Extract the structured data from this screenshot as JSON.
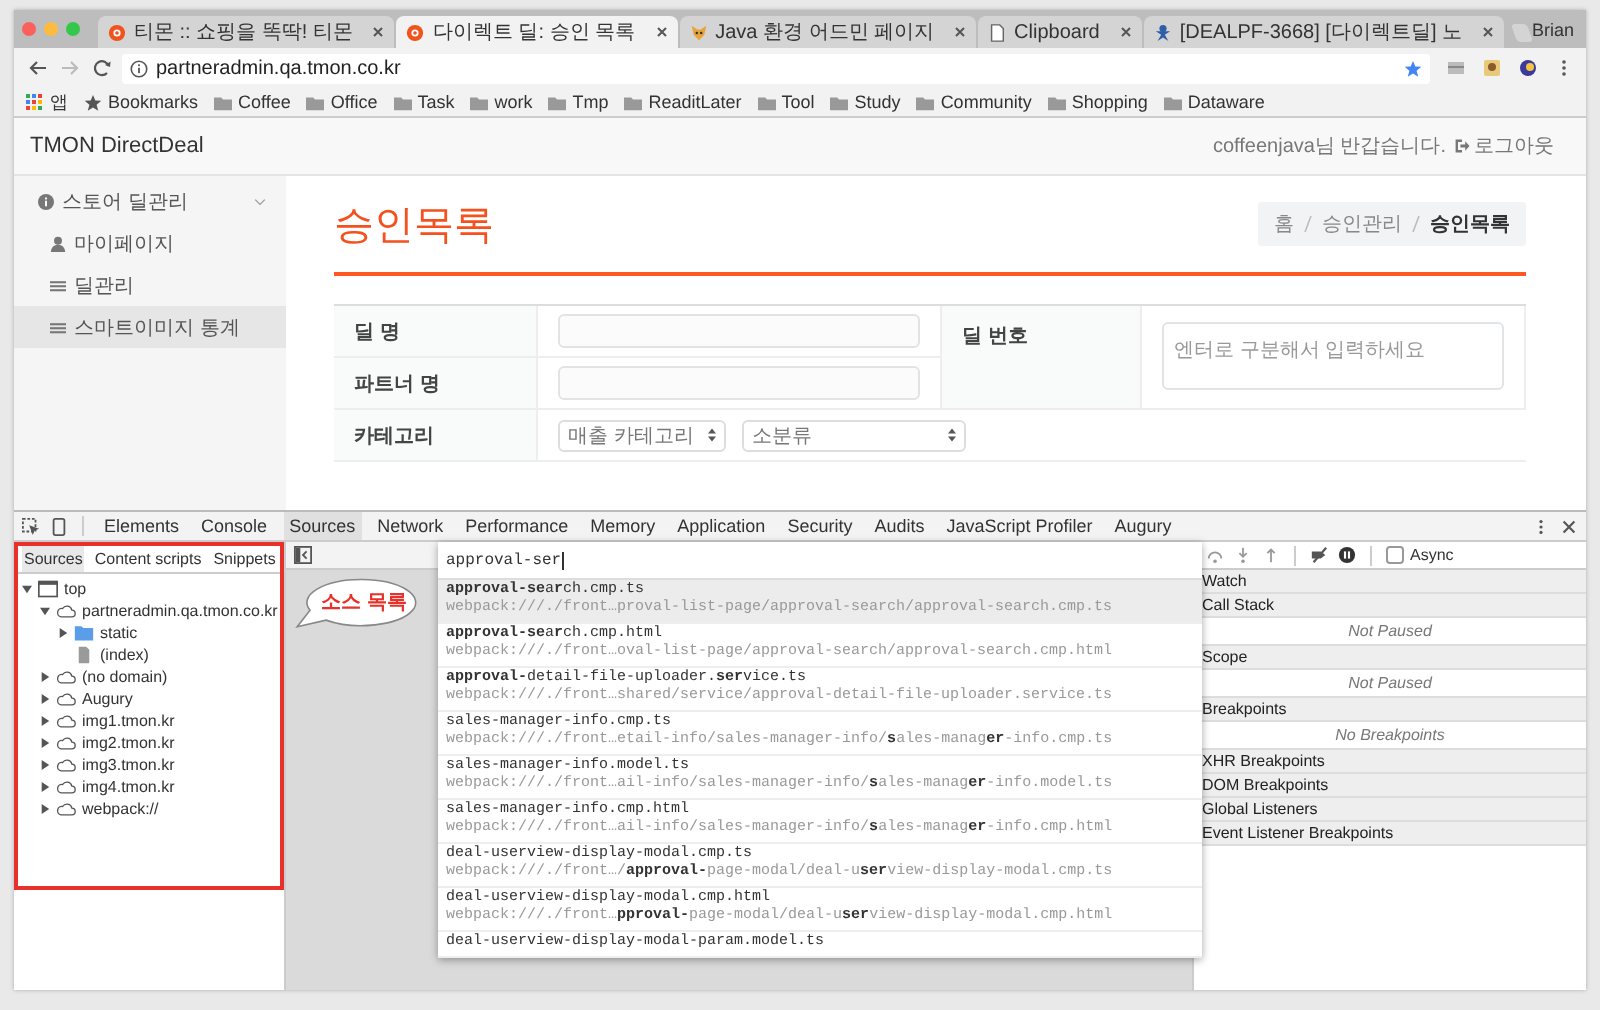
{
  "browser": {
    "tabs": [
      {
        "title": "티몬 :: 쇼핑을 똑딱! 티몬",
        "kind": "circle",
        "selected": false
      },
      {
        "title": "다이렉트 딜: 승인 목록",
        "kind": "circle",
        "selected": true
      },
      {
        "title": "Java 환경 어드민 페이지",
        "kind": "fox",
        "selected": false
      },
      {
        "title": "Clipboard",
        "kind": "page",
        "selected": false
      },
      {
        "title": "[DEALPF-3668] [다이렉트딜] 노",
        "kind": "figure",
        "selected": false
      }
    ],
    "user": "Brian",
    "url": "partneradmin.qa.tmon.co.kr",
    "bookmarks": [
      {
        "label": "앱",
        "kind": "apps"
      },
      {
        "label": "Bookmarks",
        "kind": "star"
      },
      {
        "label": "Coffee",
        "kind": "folder"
      },
      {
        "label": "Office",
        "kind": "folder"
      },
      {
        "label": "Task",
        "kind": "folder"
      },
      {
        "label": "work",
        "kind": "folder"
      },
      {
        "label": "Tmp",
        "kind": "folder"
      },
      {
        "label": "ReaditLater",
        "kind": "folder"
      },
      {
        "label": "Tool",
        "kind": "folder"
      },
      {
        "label": "Study",
        "kind": "folder"
      },
      {
        "label": "Community",
        "kind": "folder"
      },
      {
        "label": "Shopping",
        "kind": "folder"
      },
      {
        "label": "Dataware",
        "kind": "folder"
      }
    ]
  },
  "page": {
    "brand": "TMON DirectDeal",
    "greeting": "coffeenjava님 반갑습니다.",
    "logout": "로그아웃",
    "sidebar": {
      "group": {
        "label": "스토어 딜관리",
        "expanded": true
      },
      "items": [
        {
          "label": "마이페이지",
          "kind": "user",
          "selected": false
        },
        {
          "label": "딜관리",
          "kind": "list",
          "selected": false
        },
        {
          "label": "스마트이미지 통계",
          "kind": "list",
          "selected": true
        }
      ]
    },
    "title": "승인목록",
    "breadcrumb": [
      {
        "label": "홈",
        "current": false
      },
      {
        "label": "승인관리",
        "current": false
      },
      {
        "label": "승인목록",
        "current": true
      }
    ],
    "form": {
      "deal_name": "딜 명",
      "partner_name": "파트너 명",
      "deal_number": "딜 번호",
      "deal_number_placeholder": "엔터로 구분해서 입력하세요",
      "category": "카테고리",
      "selects": [
        "매출 카테고리",
        "소분류"
      ]
    }
  },
  "devtools": {
    "tabs": [
      {
        "label": "Elements",
        "selected": false
      },
      {
        "label": "Console",
        "selected": false
      },
      {
        "label": "Sources",
        "selected": true
      },
      {
        "label": "Network",
        "selected": false
      },
      {
        "label": "Performance",
        "selected": false
      },
      {
        "label": "Memory",
        "selected": false
      },
      {
        "label": "Application",
        "selected": false
      },
      {
        "label": "Security",
        "selected": false
      },
      {
        "label": "Audits",
        "selected": false
      },
      {
        "label": "JavaScript Profiler",
        "selected": false
      },
      {
        "label": "Augury",
        "selected": false
      }
    ],
    "navigator": {
      "tabs": [
        {
          "label": "Sources",
          "selected": true
        },
        {
          "label": "Content scripts",
          "selected": false
        },
        {
          "label": "Snippets",
          "selected": false
        }
      ],
      "tree": [
        {
          "label": "top",
          "kind": "frame",
          "expanded": true,
          "children": [
            {
              "label": "partneradmin.qa.tmon.co.kr",
              "kind": "domain",
              "expanded": true,
              "children": [
                {
                  "label": "static",
                  "kind": "folder",
                  "expanded": false
                },
                {
                  "label": "(index)",
                  "kind": "file"
                }
              ]
            },
            {
              "label": "(no domain)",
              "kind": "domain",
              "expanded": false
            },
            {
              "label": "Augury",
              "kind": "domain",
              "expanded": false
            },
            {
              "label": "img1.tmon.kr",
              "kind": "domain",
              "expanded": false
            },
            {
              "label": "img2.tmon.kr",
              "kind": "domain",
              "expanded": false
            },
            {
              "label": "img3.tmon.kr",
              "kind": "domain",
              "expanded": false
            },
            {
              "label": "img4.tmon.kr",
              "kind": "domain",
              "expanded": false
            },
            {
              "label": "webpack://",
              "kind": "domain",
              "expanded": false
            }
          ]
        }
      ]
    },
    "callout": "소스 목록",
    "quick_open": {
      "query": "approval-ser",
      "results": [
        {
          "name": "**approval-se**a**r**ch.cmp.ts",
          "path": "webpack:///./front…proval-list-page/approval-search/approval-search.cmp.ts",
          "selected": true
        },
        {
          "name": "**approval-se**a**r**ch.cmp.html",
          "path": "webpack:///./front…oval-list-page/approval-search/approval-search.cmp.html",
          "selected": false
        },
        {
          "name": "**approval-**detail-file-uploader.**ser**vice.ts",
          "path": "webpack:///./front…shared/service/approval-detail-file-uploader.service.ts",
          "selected": false
        },
        {
          "name": "sales-manager-info.cmp.ts",
          "path": "webpack:///./front…etail-info/sales-manager-info/**s**ales-manag**er**-info.cmp.ts",
          "selected": false
        },
        {
          "name": "sales-manager-info.model.ts",
          "path": "webpack:///./front…ail-info/sales-manager-info/**s**ales-manag**er**-info.model.ts",
          "selected": false
        },
        {
          "name": "sales-manager-info.cmp.html",
          "path": "webpack:///./front…ail-info/sales-manager-info/**s**ales-manag**er**-info.cmp.html",
          "selected": false
        },
        {
          "name": "deal-userview-display-modal.cmp.ts",
          "path": "webpack:///./front…/**approval-**page-modal/deal-u**ser**view-display-modal.cmp.ts",
          "selected": false
        },
        {
          "name": "deal-userview-display-modal.cmp.html",
          "path": "webpack:///./front…**pproval-**page-modal/deal-u**ser**view-display-modal.cmp.html",
          "selected": false
        },
        {
          "name": "deal-userview-display-modal-param.model.ts",
          "selected": false
        }
      ]
    },
    "debugger": {
      "async": {
        "label": "Async",
        "checked": false
      },
      "sections": [
        {
          "title": "Watch"
        },
        {
          "title": "Call Stack",
          "message": "Not Paused"
        },
        {
          "title": "Scope",
          "message": "Not Paused"
        },
        {
          "title": "Breakpoints",
          "message": "No Breakpoints"
        },
        {
          "title": "XHR Breakpoints"
        },
        {
          "title": "DOM Breakpoints"
        },
        {
          "title": "Global Listeners"
        },
        {
          "title": "Event Listener Breakpoints"
        }
      ]
    }
  }
}
